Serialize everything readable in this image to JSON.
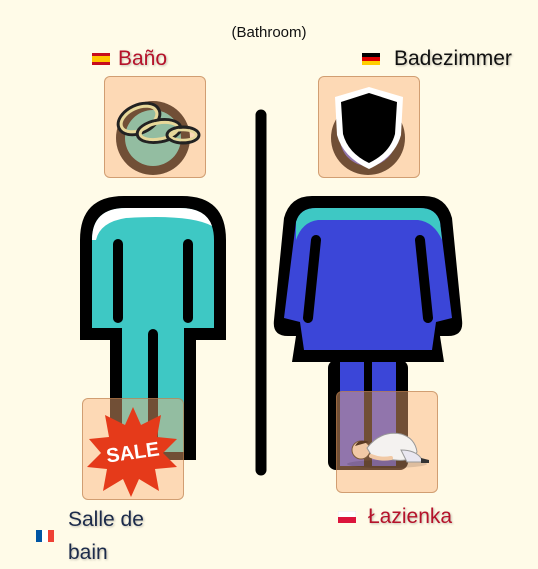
{
  "title": "(Bathroom)",
  "labels": {
    "es": "Baño",
    "de": "Badezimmer",
    "fr": "Salle de bain",
    "pl": "Łazienka"
  },
  "colors": {
    "background": "#fffbe8",
    "label_red": "#b5122a",
    "label_dark": "#1b2a4a",
    "man_fill": "#3ec8c4",
    "woman_fill": "#3b46d8",
    "outline": "#000000"
  },
  "icons": [
    "rings-icon",
    "shield-icon",
    "sale-icon",
    "kneeling-person-icon"
  ],
  "sale_text": "SALE"
}
